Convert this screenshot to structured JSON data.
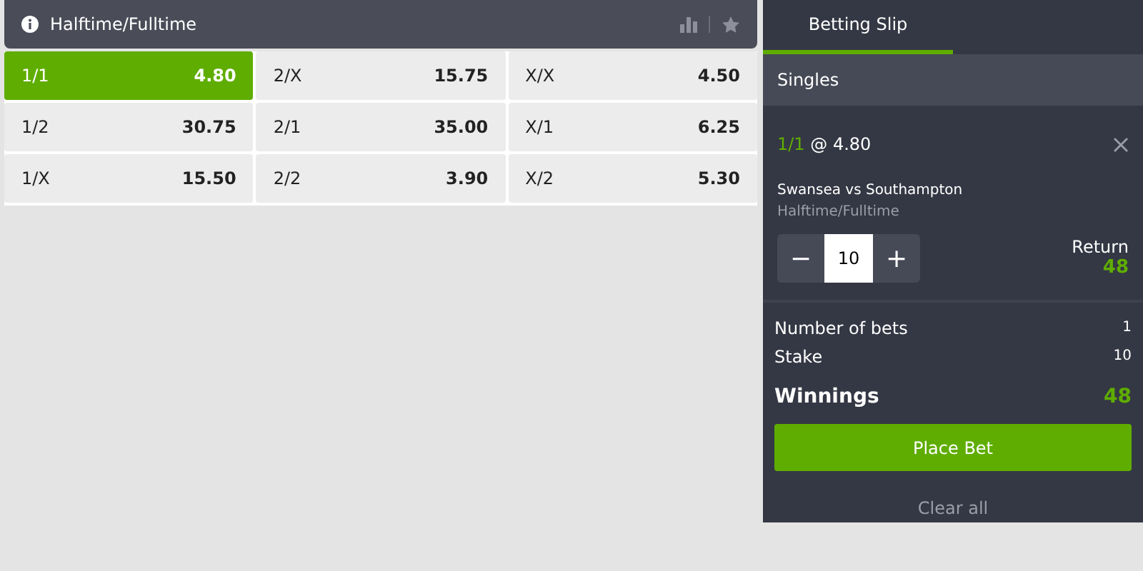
{
  "market": {
    "title": "Halftime/Fulltime",
    "outcomes": [
      {
        "label": "1/1",
        "odds": "4.80",
        "selected": true
      },
      {
        "label": "2/X",
        "odds": "15.75",
        "selected": false
      },
      {
        "label": "X/X",
        "odds": "4.50",
        "selected": false
      },
      {
        "label": "1/2",
        "odds": "30.75",
        "selected": false
      },
      {
        "label": "2/1",
        "odds": "35.00",
        "selected": false
      },
      {
        "label": "X/1",
        "odds": "6.25",
        "selected": false
      },
      {
        "label": "1/X",
        "odds": "15.50",
        "selected": false
      },
      {
        "label": "2/2",
        "odds": "3.90",
        "selected": false
      },
      {
        "label": "X/2",
        "odds": "5.30",
        "selected": false
      }
    ]
  },
  "slip": {
    "tabs": [
      {
        "label": "Betting Slip",
        "selected": true
      }
    ],
    "section": "Singles",
    "bet": {
      "pick": "1/1",
      "at": "@",
      "odds": "4.80",
      "match": [
        "Swansea",
        "vs",
        "Southampton"
      ],
      "market": "Halftime/Fulltime",
      "minus": "−",
      "stake": "10",
      "plus": "+",
      "return_label": "Return",
      "return_value": "48"
    },
    "summary": [
      {
        "label": "Number of bets",
        "value": "1"
      },
      {
        "label": "Stake",
        "value": "10"
      }
    ],
    "winnings": {
      "label": "Winnings",
      "value": "48"
    },
    "place_button": "Place Bet",
    "clear": "Clear all"
  }
}
